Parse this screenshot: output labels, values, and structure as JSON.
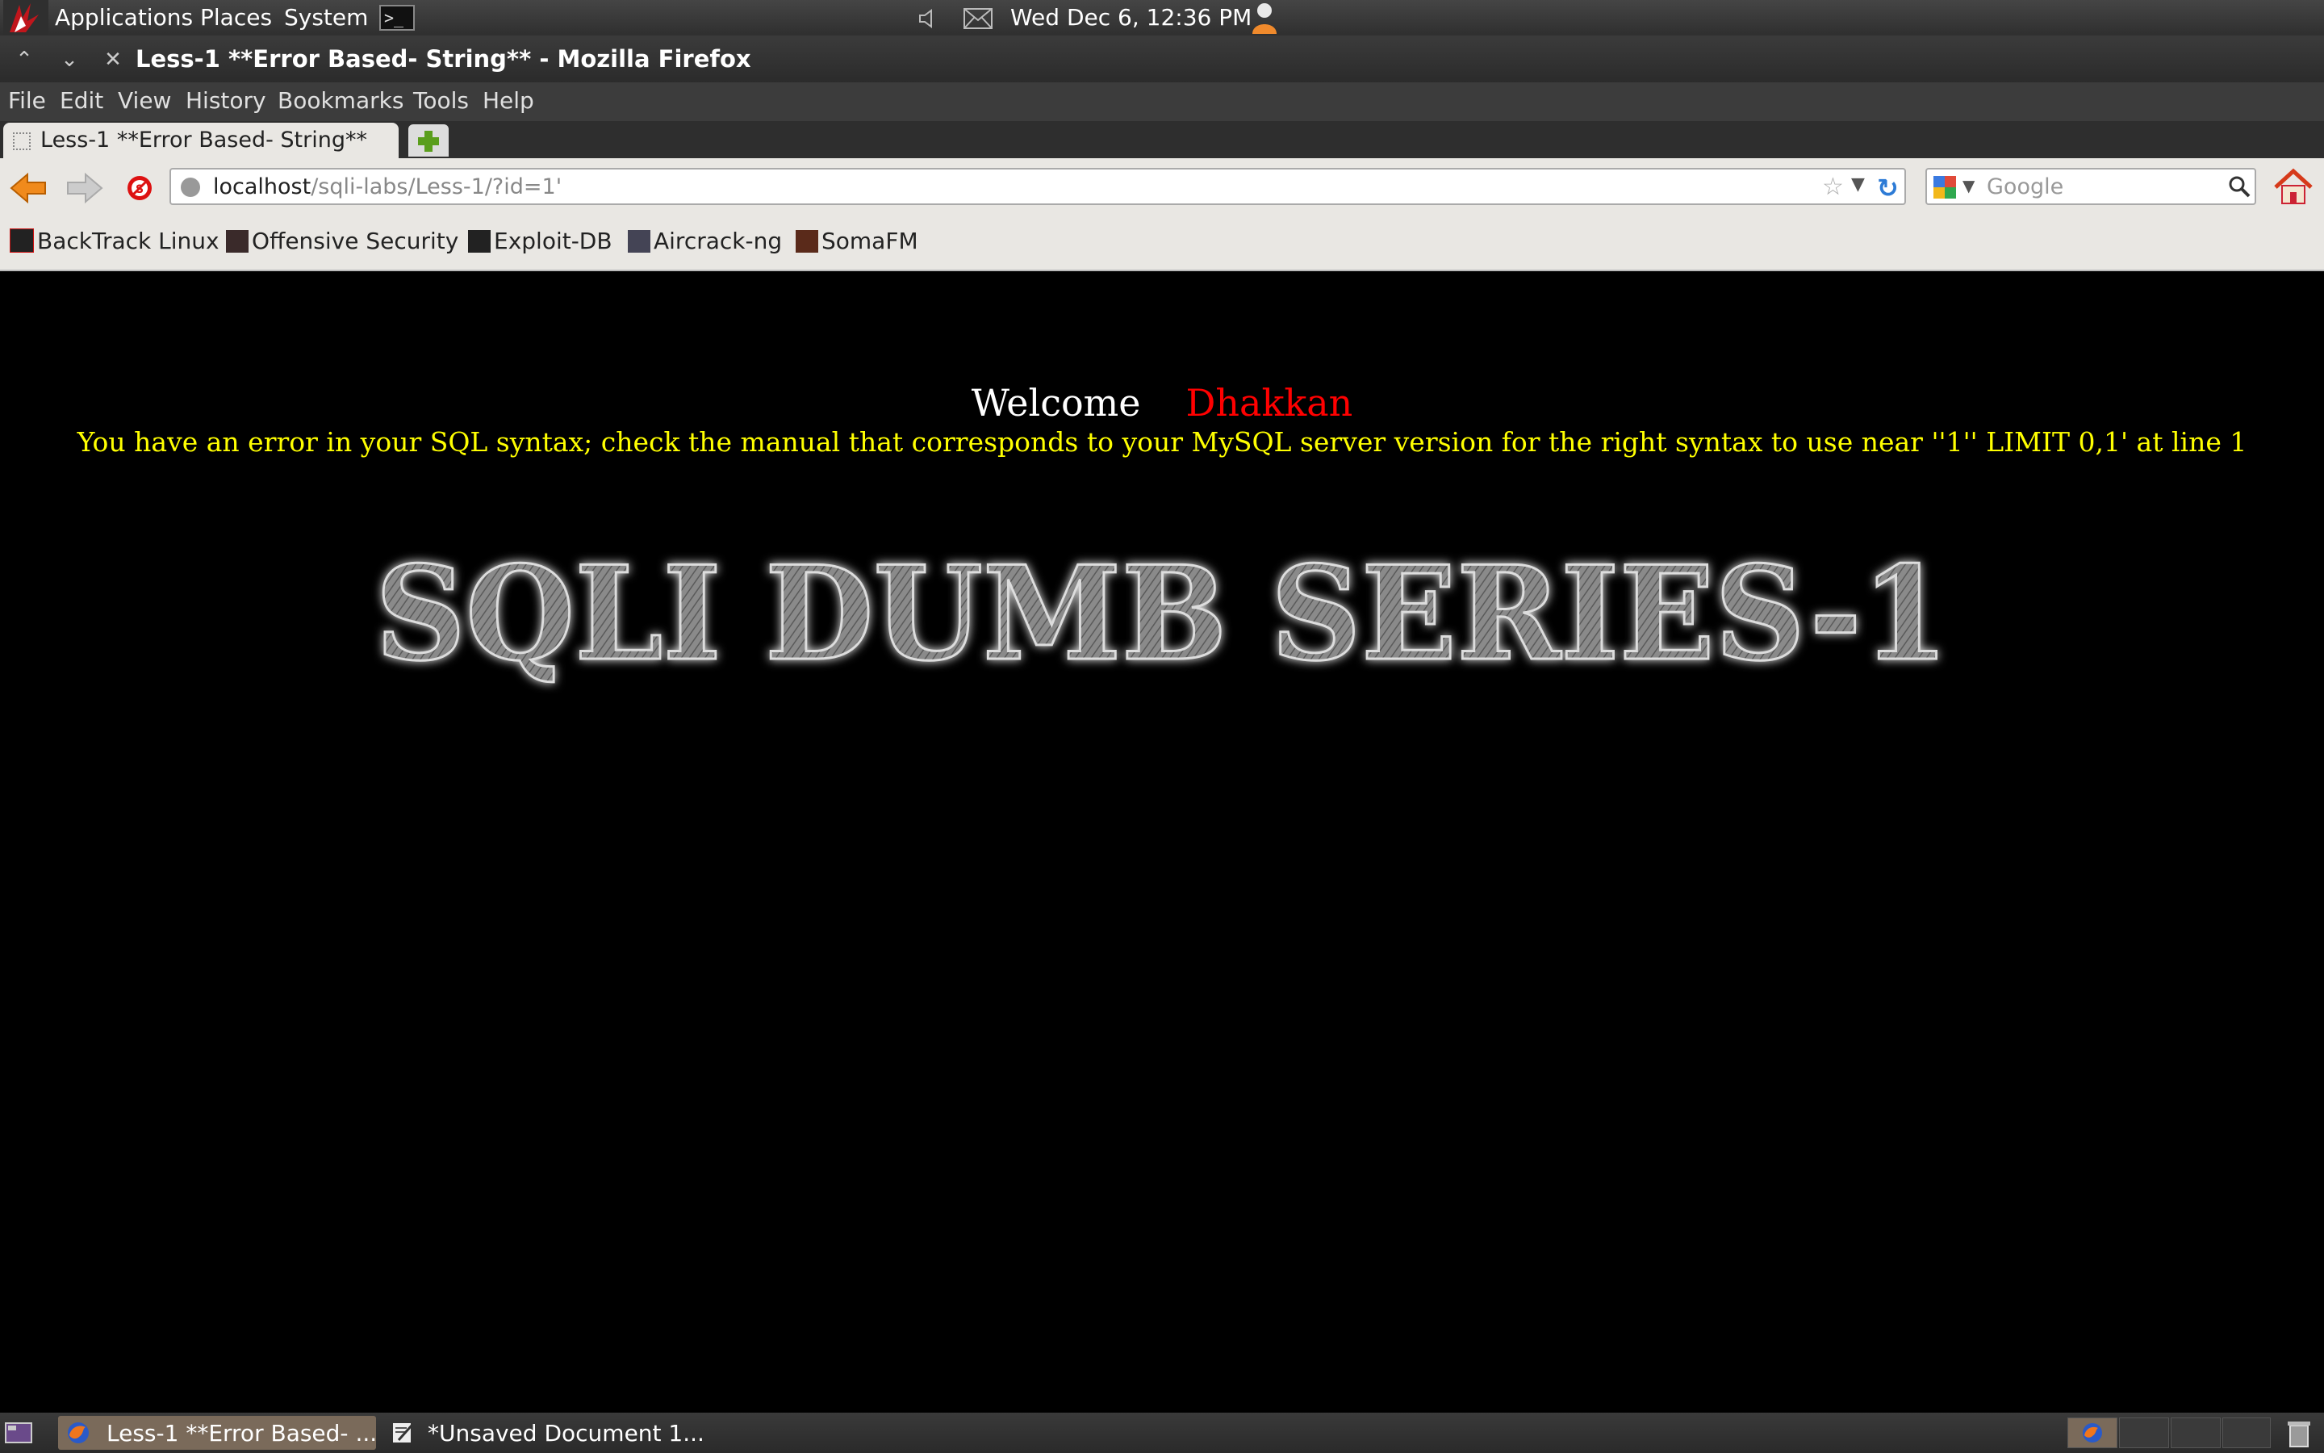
{
  "panel": {
    "menus": [
      "Applications",
      "Places",
      "System"
    ],
    "clock": "Wed Dec  6, 12:36 PM"
  },
  "window": {
    "title": "Less-1 **Error Based- String** - Mozilla Firefox"
  },
  "menubar": {
    "items": [
      "File",
      "Edit",
      "View",
      "History",
      "Bookmarks",
      "Tools",
      "Help"
    ]
  },
  "tabs": {
    "active_label": "Less-1 **Error Based- String**"
  },
  "navbar": {
    "url_host": "localhost",
    "url_path": "/sqli-labs/Less-1/?id=1'",
    "search_placeholder": "Google"
  },
  "bookmarks": [
    "BackTrack Linux",
    "Offensive Security",
    "Exploit-DB",
    "Aircrack-ng",
    "SomaFM"
  ],
  "page": {
    "welcome": "Welcome",
    "name": "Dhakkan",
    "error": "You have an error in your SQL syntax; check the manual that corresponds to your MySQL server version for the right syntax to use near ''1'' LIMIT 0,1' at line 1",
    "banner": "SQLI DUMB SERIES-1"
  },
  "taskbar": {
    "tasks": [
      "Less-1 **Error Based- ...",
      "*Unsaved Document 1..."
    ]
  },
  "colors": {
    "welcome_name": "#ff0000",
    "error_text": "#ffff00",
    "page_bg": "#000000"
  }
}
